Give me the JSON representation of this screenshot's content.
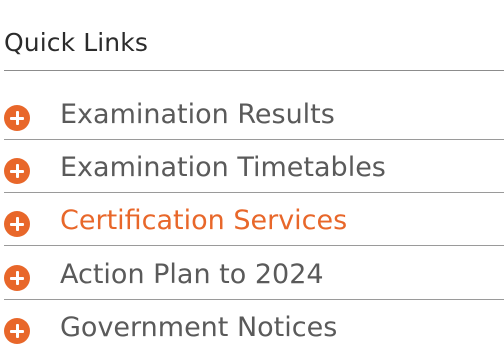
{
  "quick_links": {
    "title": "Quick Links",
    "items": [
      {
        "label": "Examination Results",
        "active": false
      },
      {
        "label": "Examination Timetables",
        "active": false
      },
      {
        "label": "Certification Services",
        "active": true
      },
      {
        "label": "Action Plan to 2024",
        "active": false
      },
      {
        "label": "Government Notices",
        "active": false
      }
    ],
    "icon": "plus-circle-icon",
    "colors": {
      "accent": "#e8672a",
      "text": "#5a5a5a",
      "title": "#2b2b2b",
      "rule": "#9a9a9a"
    }
  }
}
